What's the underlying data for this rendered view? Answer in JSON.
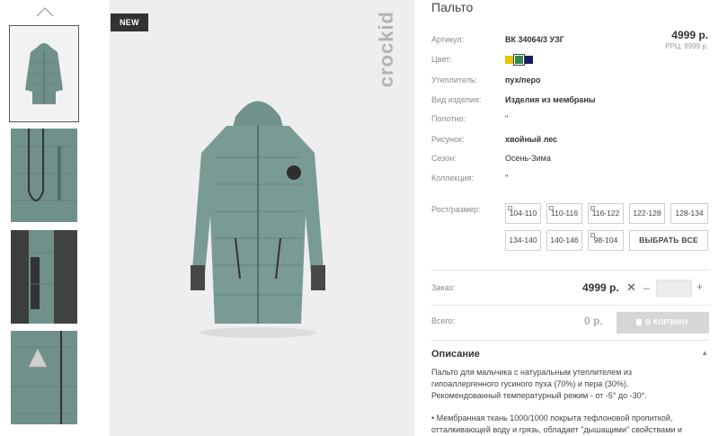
{
  "thumbs": {
    "up_icon": "chevron-up-icon",
    "items": [
      "coat-front",
      "coat-zipper-detail",
      "coat-pocket-detail",
      "coat-reflector-detail"
    ]
  },
  "main_image": {
    "badge": "NEW",
    "brand": "crockid"
  },
  "product": {
    "title": "Пальто",
    "price": "4999 р.",
    "rrp": "РРЦ: 8999 р.",
    "attrs": [
      {
        "label": "Артикул:",
        "value": "ВК 34064/3 УЗГ"
      },
      {
        "label": "Цвет:",
        "value": ""
      },
      {
        "label": "Утеплитель:",
        "value": "пух/перо"
      },
      {
        "label": "Вид изделия:",
        "value": "Изделия из мембраны"
      },
      {
        "label": "Полотно:",
        "value": "\""
      },
      {
        "label": "Рисунок:",
        "value": "хвойный лес"
      },
      {
        "label": "Сезон:",
        "value": "Осень-Зима"
      },
      {
        "label": "Коллекция:",
        "value": "\""
      }
    ],
    "colors": [
      "#e8c400",
      "#2f8a4e",
      "#1a1a6b"
    ],
    "size_label": "Рост/размер:",
    "sizes": [
      "104-110",
      "110-116",
      "116-122",
      "122-128",
      "128-134",
      "134-140",
      "140-146",
      "98-104"
    ],
    "select_all": "ВЫБРАТЬ ВСЕ"
  },
  "order": {
    "label": "Заказ:",
    "price": "4999 р.",
    "times": "✕",
    "minus": "–",
    "plus": "+",
    "qty": ""
  },
  "total": {
    "label": "Всего:",
    "value": "0 р.",
    "cart_button": "В КОРЗИНУ"
  },
  "description": {
    "heading": "Описание",
    "line1": "Пальто для мальчика с натуральным утеплителем из",
    "line2": "гипоаллергенного гусиного пуха (70%) и пера (30%).",
    "line3": "Рекомендованный температурный режим - от -5° до -30°.",
    "line4": "• Мембранная ткань 1000/1000 покрыта тефлоновой пропиткой,",
    "line5": "отталкивающей воду и грязь, обладает \"дышащими\" свойствами и"
  }
}
